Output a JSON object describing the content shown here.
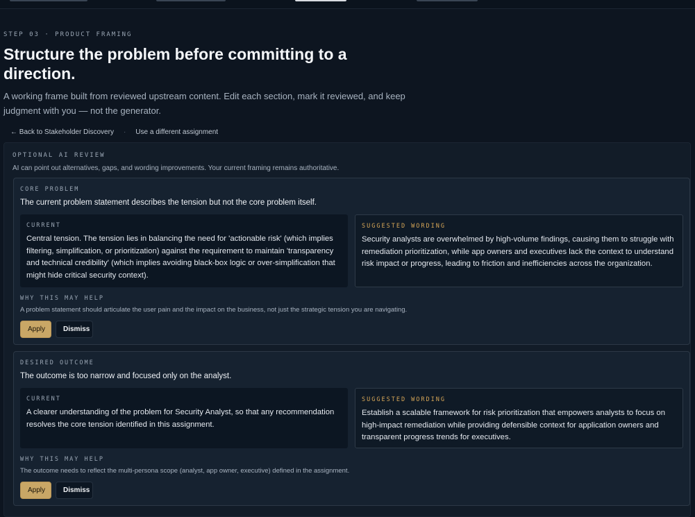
{
  "header": {
    "eyebrow": "STEP 03 · PRODUCT FRAMING",
    "title": "Structure the problem before committing to a direction.",
    "subtitle": "A working frame built from reviewed upstream content. Edit each section, mark it reviewed, and keep judgment with you — not the generator."
  },
  "links": {
    "back": "← Back to Stakeholder Discovery",
    "separator": "·",
    "other": "Use a different assignment"
  },
  "review": {
    "eyebrow": "OPTIONAL AI REVIEW",
    "description": "AI can point out alternatives, gaps, and wording improvements. Your current framing remains authoritative."
  },
  "labels": {
    "current": "CURRENT",
    "suggested": "SUGGESTED WORDING",
    "why": "WHY THIS MAY HELP",
    "apply": "Apply",
    "dismiss": "Dismiss"
  },
  "suggestions": [
    {
      "section": "CORE PROBLEM",
      "summary": "The current problem statement describes the tension but not the core problem itself.",
      "current": "Central tension. The tension lies in balancing the need for 'actionable risk' (which implies filtering, simplification, or prioritization) against the requirement to maintain 'transparency and technical credibility' (which implies avoiding black-box logic or over-simplification that might hide critical security context).",
      "suggested": "Security analysts are overwhelmed by high-volume findings, causing them to struggle with remediation prioritization, while app owners and executives lack the context to understand risk impact or progress, leading to friction and inefficiencies across the organization.",
      "why": "A problem statement should articulate the user pain and the impact on the business, not just the strategic tension you are navigating."
    },
    {
      "section": "DESIRED OUTCOME",
      "summary": "The outcome is too narrow and focused only on the analyst.",
      "current": "A clearer understanding of the problem for Security Analyst, so that any recommendation resolves the core tension identified in this assignment.",
      "suggested": "Establish a scalable framework for risk prioritization that empowers analysts to focus on high-impact remediation while providing defensible context for application owners and transparent progress trends for executives.",
      "why": "The outcome needs to reflect the multi-persona scope (analyst, app owner, executive) defined in the assignment."
    }
  ]
}
